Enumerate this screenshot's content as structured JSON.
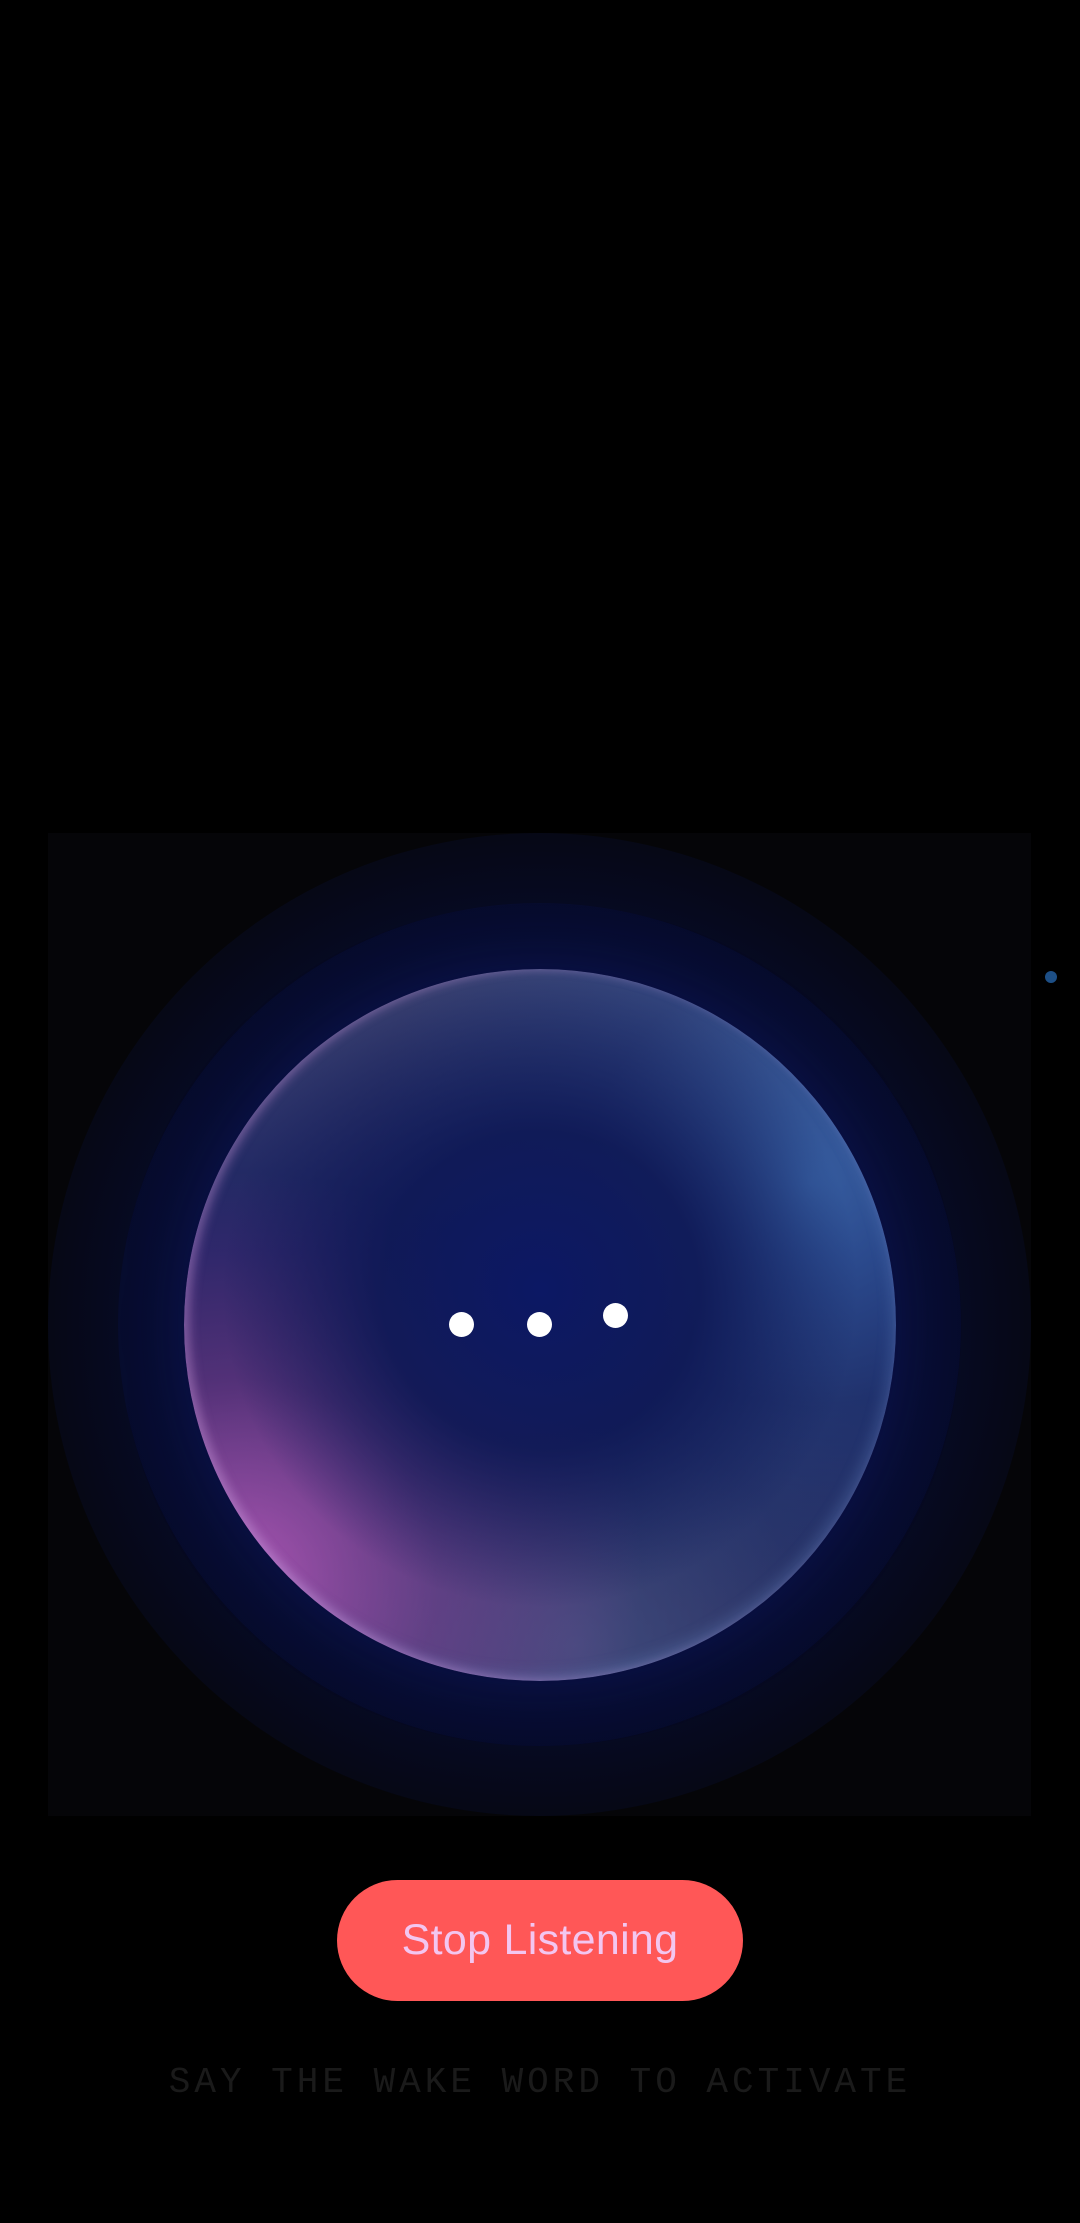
{
  "voice_assistant": {
    "state": "listening",
    "typing_indicator_dots": 3,
    "icons": {
      "typing_indicator": "ellipsis-dots-icon",
      "side_indicator": "status-dot-icon"
    },
    "colors": {
      "background": "#000000",
      "orb_core": "#0c1864",
      "orb_glow_magenta": "#be5abe",
      "orb_glow_blue": "#3c6eb4",
      "button": "#ff5757",
      "button_text": "#f3c6f0",
      "hint_text": "#1a1a1a",
      "side_indicator": "#1d4f86"
    }
  },
  "controls": {
    "stop_label": "Stop Listening"
  },
  "hint": {
    "text": "SAY THE WAKE WORD TO ACTIVATE"
  }
}
